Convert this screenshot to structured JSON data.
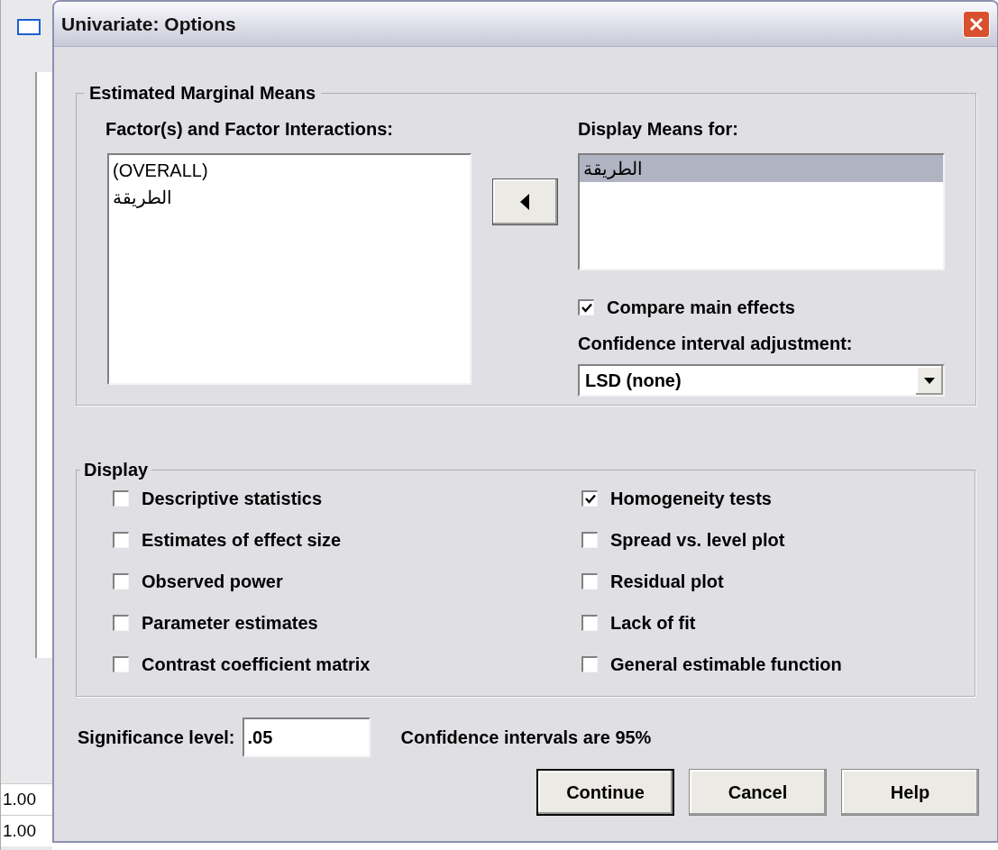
{
  "background_window": {
    "cells": [
      "1.00",
      "1.00"
    ]
  },
  "window": {
    "title": "Univariate: Options"
  },
  "estimated_marginal_means": {
    "title": "Estimated Marginal Means",
    "factors": {
      "label": "Factor(s) and Factor Interactions:",
      "items": [
        {
          "text": "(OVERALL)",
          "selected": false
        },
        {
          "text": "الطريقة",
          "selected": false
        }
      ]
    },
    "display_means": {
      "label": "Display Means for:",
      "items": [
        {
          "text": "الطريقة",
          "selected": true
        }
      ]
    },
    "compare_main_effects": {
      "label": "Compare main effects",
      "checked": true
    },
    "adjustment": {
      "label": "Confidence interval adjustment:",
      "value": "LSD (none)"
    }
  },
  "display": {
    "title": "Display",
    "left": [
      {
        "label": "Descriptive statistics",
        "checked": false
      },
      {
        "label": "Estimates of effect size",
        "checked": false
      },
      {
        "label": "Observed power",
        "checked": false
      },
      {
        "label": "Parameter estimates",
        "checked": false
      },
      {
        "label": "Contrast coefficient matrix",
        "checked": false
      }
    ],
    "right": [
      {
        "label": "Homogeneity tests",
        "checked": true
      },
      {
        "label": "Spread vs. level plot",
        "checked": false
      },
      {
        "label": "Residual plot",
        "checked": false
      },
      {
        "label": "Lack of fit",
        "checked": false
      },
      {
        "label": "General estimable function",
        "checked": false
      }
    ]
  },
  "significance": {
    "label": "Significance level:",
    "value": ".05"
  },
  "confidence_note": "Confidence intervals are 95%",
  "buttons": [
    {
      "label": "Continue",
      "default": true
    },
    {
      "label": "Cancel",
      "default": false
    },
    {
      "label": "Help",
      "default": false
    }
  ]
}
